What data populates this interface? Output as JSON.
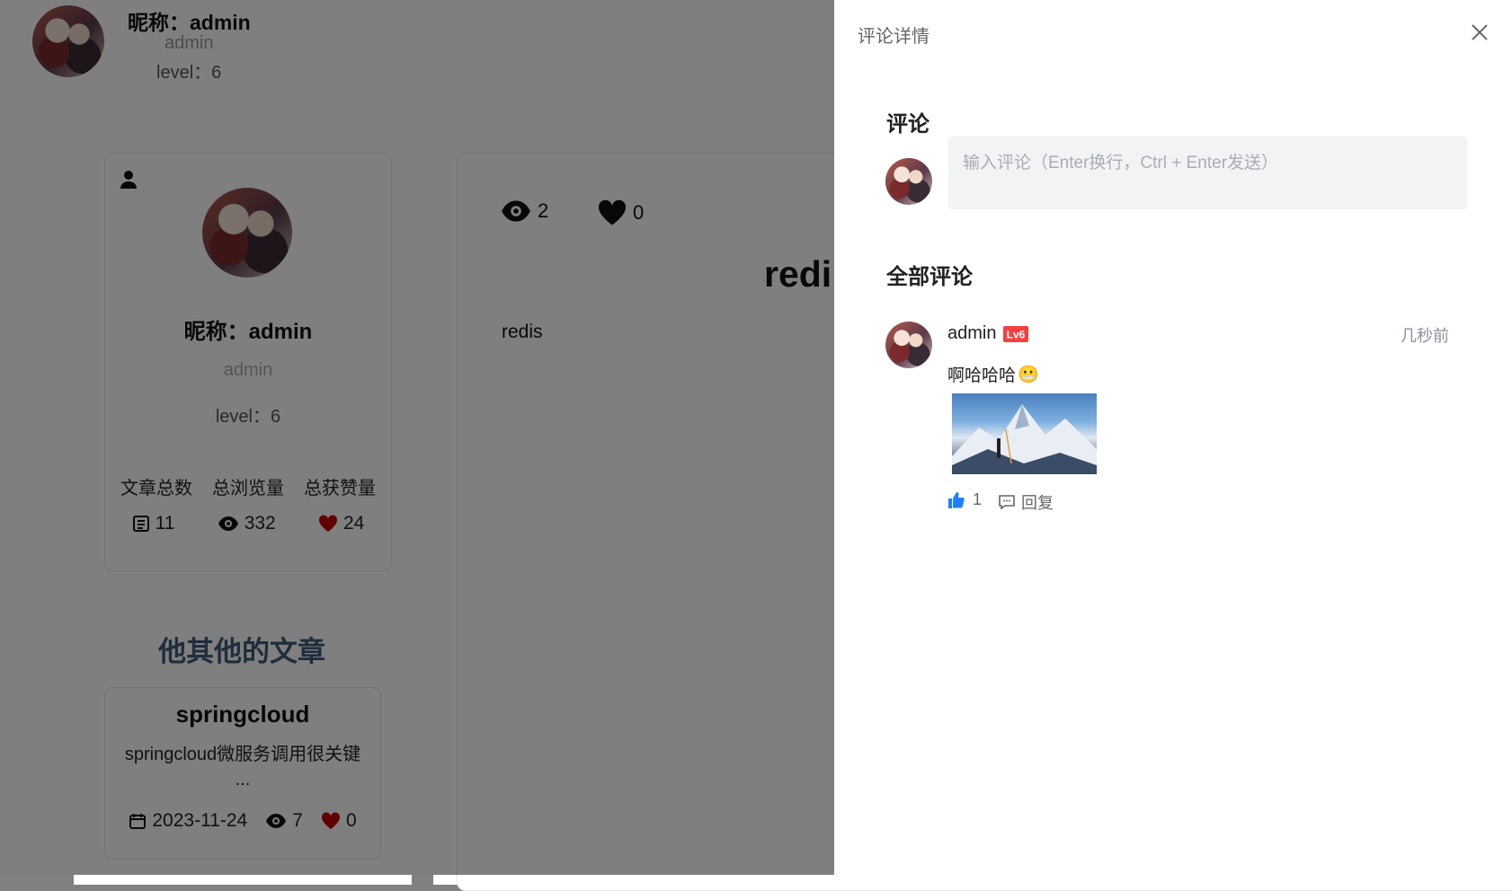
{
  "header": {
    "nickname": "昵称：admin",
    "username": "admin",
    "level": "level：6"
  },
  "profile": {
    "nickname": "昵称：admin",
    "username": "admin",
    "level": "level：6",
    "stats": [
      {
        "label": "文章总数",
        "value": "11",
        "icon": "articles-icon"
      },
      {
        "label": "总浏览量",
        "value": "332",
        "icon": "eye-icon"
      },
      {
        "label": "总获赞量",
        "value": "24",
        "icon": "heart-icon"
      }
    ]
  },
  "other_articles": {
    "title": "他其他的文章",
    "items": [
      {
        "title": "springcloud",
        "desc": "springcloud微服务调用很关键",
        "ellipsis": "...",
        "date": "2023-11-24",
        "views": "7",
        "likes": "0"
      }
    ]
  },
  "article": {
    "views": "2",
    "likes": "0",
    "title_visible": "redi",
    "body": "redis"
  },
  "drawer": {
    "title": "评论详情",
    "comment_heading": "评论",
    "input_placeholder": "输入评论（Enter换行，Ctrl + Enter发送）",
    "all_heading": "全部评论",
    "comments": [
      {
        "author": "admin",
        "badge": "Lv6",
        "time": "几秒前",
        "text": "啊哈哈哈",
        "emoji": "😬",
        "likes": "1",
        "reply_label": "回复"
      }
    ]
  },
  "colors": {
    "accent_blue": "#1e80ff",
    "heart_red": "#c00000",
    "badge_red": "#f53f3f",
    "section_title": "#3e5a78"
  }
}
